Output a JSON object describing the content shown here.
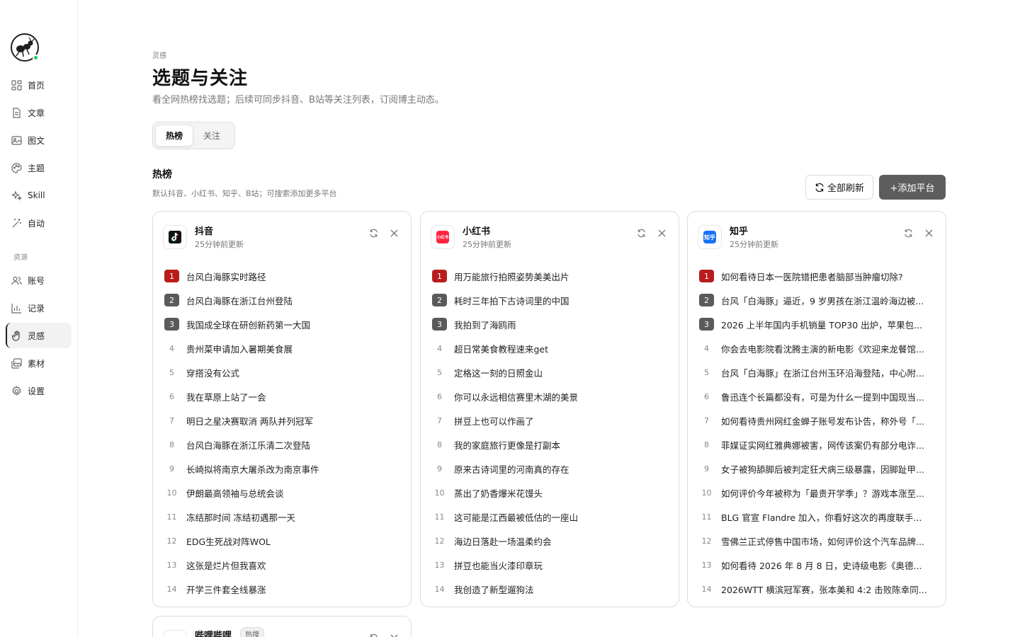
{
  "sidebar": {
    "logo": {
      "icon": "ant-logo-icon",
      "status_color": "#22c55e"
    },
    "items": [
      {
        "label": "首页",
        "icon": "grid-icon"
      },
      {
        "label": "文章",
        "icon": "document-icon"
      },
      {
        "label": "图文",
        "icon": "image-icon"
      },
      {
        "label": "主题",
        "icon": "palette-icon"
      },
      {
        "label": "Skill",
        "icon": "sparkle-icon"
      },
      {
        "label": "自动",
        "icon": "magic-wand-icon"
      }
    ],
    "section_label": "资源",
    "resource_items": [
      {
        "label": "账号",
        "icon": "users-icon"
      },
      {
        "label": "记录",
        "icon": "bar-chart-icon"
      },
      {
        "label": "灵感",
        "icon": "hand-icon",
        "active": true
      },
      {
        "label": "素材",
        "icon": "gallery-icon"
      },
      {
        "label": "设置",
        "icon": "gear-icon"
      }
    ]
  },
  "header": {
    "kicker": "灵感",
    "title": "选题与关注",
    "description": "看全网热榜找选题；后续可同步抖音、B站等关注列表，订阅博主动态。"
  },
  "tabs": [
    {
      "label": "热榜",
      "active": true
    },
    {
      "label": "关注",
      "active": false
    }
  ],
  "section": {
    "title": "热榜",
    "description": "默认抖音、小红书、知乎、B站；可搜索添加更多平台",
    "refresh_all_label": "全部刷新",
    "add_platform_label": "+添加平台"
  },
  "colors": {
    "accent": "#5d5d5d",
    "rank1": "#b91c1c",
    "rank23": "#5a5a5a"
  },
  "cards": [
    {
      "name": "抖音",
      "icon": "douyin-icon",
      "updated": "25分钟前更新",
      "items": [
        {
          "rank": "1",
          "title": "台风白海豚实时路径"
        },
        {
          "rank": "2",
          "title": "台风白海豚在浙江台州登陆"
        },
        {
          "rank": "3",
          "title": "我国成全球在研创新药第一大国"
        },
        {
          "rank": "4",
          "title": "贵州菜申请加入暑期美食展"
        },
        {
          "rank": "5",
          "title": "穿搭没有公式"
        },
        {
          "rank": "6",
          "title": "我在草原上站了一会"
        },
        {
          "rank": "7",
          "title": "明日之星决赛取消 两队并列冠军"
        },
        {
          "rank": "8",
          "title": "台风白海豚在浙江乐清二次登陆"
        },
        {
          "rank": "9",
          "title": "长崎拟将南京大屠杀改为南京事件"
        },
        {
          "rank": "10",
          "title": "伊朗最高领袖与总统会谈"
        },
        {
          "rank": "11",
          "title": "冻结那时间 冻结初遇那一天"
        },
        {
          "rank": "12",
          "title": "EDG生死战对阵WOL"
        },
        {
          "rank": "13",
          "title": "这张是烂片但我喜欢"
        },
        {
          "rank": "14",
          "title": "开学三件套全线暴涨"
        }
      ]
    },
    {
      "name": "小红书",
      "icon": "xiaohongshu-icon",
      "icon_text": "小红书",
      "updated": "25分钟前更新",
      "items": [
        {
          "rank": "1",
          "title": "用万能旅行拍照姿势美美出片"
        },
        {
          "rank": "2",
          "title": "耗时三年拍下古诗词里的中国"
        },
        {
          "rank": "3",
          "title": "我拍到了海鸥雨"
        },
        {
          "rank": "4",
          "title": "超日常美食教程速来get"
        },
        {
          "rank": "5",
          "title": "定格这一刻的日照金山"
        },
        {
          "rank": "6",
          "title": "你可以永远相信赛里木湖的美景"
        },
        {
          "rank": "7",
          "title": "拼豆上也可以作画了"
        },
        {
          "rank": "8",
          "title": "我的家庭旅行更像是打副本"
        },
        {
          "rank": "9",
          "title": "原来古诗词里的河南真的存在"
        },
        {
          "rank": "10",
          "title": "蒸出了奶香爆米花馒头"
        },
        {
          "rank": "11",
          "title": "这可能是江西最被低估的一座山"
        },
        {
          "rank": "12",
          "title": "海边日落赴一场温柔约会"
        },
        {
          "rank": "13",
          "title": "拼豆也能当火漆印章玩"
        },
        {
          "rank": "14",
          "title": "我创造了新型遛狗法"
        }
      ]
    },
    {
      "name": "知乎",
      "icon": "zhihu-icon",
      "icon_text": "知乎",
      "updated": "25分钟前更新",
      "items": [
        {
          "rank": "1",
          "title": "如何看待日本一医院错把患者脑部当肿瘤切除?"
        },
        {
          "rank": "2",
          "title": "台风「白海豚」逼近，9 岁男孩在浙江温岭海边被..."
        },
        {
          "rank": "3",
          "title": "2026 上半年国内手机销量 TOP30 出炉，苹果包..."
        },
        {
          "rank": "4",
          "title": "你会去电影院看沈腾主演的新电影《欢迎来龙餐馆..."
        },
        {
          "rank": "5",
          "title": "台风「白海豚」在浙江台州玉环沿海登陆，中心附..."
        },
        {
          "rank": "6",
          "title": "鲁迅连个长篇都没有，可是为什么一提到中国现当..."
        },
        {
          "rank": "7",
          "title": "如何看待贵州网红金蝉子账号发布讣告，称外号「..."
        },
        {
          "rank": "8",
          "title": "菲媒证实网红雅典娜被害，网传该案仍有部分电诈..."
        },
        {
          "rank": "9",
          "title": "女子被狗舔脚后被判定狂犬病三级暴露，因脚趾甲..."
        },
        {
          "rank": "10",
          "title": "如何评价今年被称为「最贵开学季」？游戏本涨至..."
        },
        {
          "rank": "11",
          "title": "BLG 官宣 Flandre 加入，你看好这次的再度联手..."
        },
        {
          "rank": "12",
          "title": "雪佛兰正式停售中国市场，如何评价这个汽车品牌..."
        },
        {
          "rank": "13",
          "title": "如何看待 2026 年 8 月 8 日，史诗级电影《奥德..."
        },
        {
          "rank": "14",
          "title": "2026WTT 横滨冠军赛，张本美和 4:2 击败陈幸同..."
        }
      ]
    }
  ],
  "partial_card": {
    "name": "哔哩哔哩",
    "badge": "热搜"
  }
}
